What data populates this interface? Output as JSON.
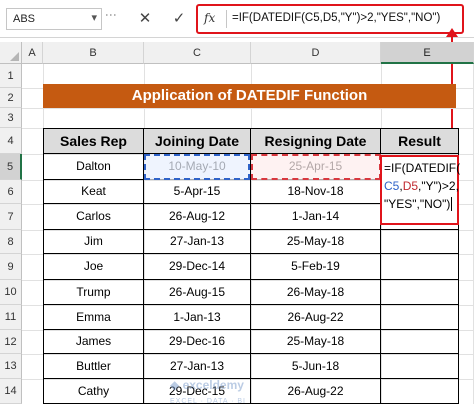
{
  "formula_bar": {
    "name_box": "ABS",
    "cancel_symbol": "✕",
    "enter_symbol": "✓",
    "fx_label": "fx",
    "formula": "=IF(DATEDIF(C5,D5,\"Y\")>2,\"YES\",\"NO\")"
  },
  "columns": [
    "A",
    "B",
    "C",
    "D",
    "E"
  ],
  "selected_column": "E",
  "rows": [
    "1",
    "2",
    "3",
    "4",
    "5",
    "6",
    "7",
    "8",
    "9",
    "10",
    "11",
    "12",
    "13",
    "14",
    "15"
  ],
  "selected_row": "5",
  "title": "Application of DATEDIF Function",
  "table": {
    "headers": [
      "Sales Rep",
      "Joining Date",
      "Resigning Date",
      "Result"
    ],
    "rows": [
      [
        "Dalton",
        "10-May-10",
        "25-Apr-15",
        ""
      ],
      [
        "Keat",
        "5-Apr-15",
        "18-Nov-18",
        ""
      ],
      [
        "Carlos",
        "26-Aug-12",
        "1-Jan-14",
        ""
      ],
      [
        "Jim",
        "27-Jan-13",
        "25-May-18",
        ""
      ],
      [
        "Joe",
        "29-Dec-14",
        "5-Feb-19",
        ""
      ],
      [
        "Trump",
        "26-Aug-15",
        "26-May-18",
        ""
      ],
      [
        "Emma",
        "1-Jan-13",
        "26-Aug-22",
        ""
      ],
      [
        "James",
        "29-Dec-16",
        "25-May-18",
        ""
      ],
      [
        "Buttler",
        "27-Jan-13",
        "5-Jun-18",
        ""
      ],
      [
        "Cathy",
        "29-Dec-15",
        "26-Aug-22",
        ""
      ]
    ]
  },
  "in_cell_edit": {
    "line1": "=IF(DATEDIF(",
    "line2_c5": "C5",
    "line2_comma1": ",",
    "line2_d5": "D5",
    "line2_rest": ",\"Y\")>2,",
    "line3": "\"YES\",\"NO\")"
  },
  "watermark": {
    "brand": "exceldemy",
    "tagline": "EXCEL · DATA · BI"
  },
  "colors": {
    "title_bg": "#c55a11",
    "highlight_red": "#e0141b",
    "ref_blue": "#2e62c8",
    "excel_green": "#217346"
  }
}
